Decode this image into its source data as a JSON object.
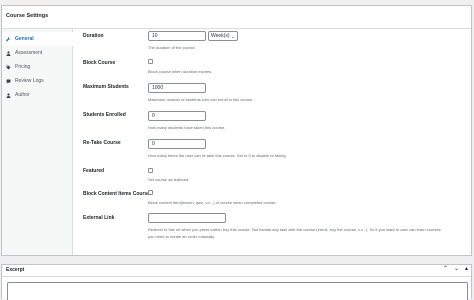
{
  "panel": {
    "title": "Course Settings"
  },
  "tabs": [
    {
      "label": "General",
      "icon": "wrench-icon",
      "active": true
    },
    {
      "label": "Assessment",
      "icon": "user-icon",
      "active": false
    },
    {
      "label": "Pricing",
      "icon": "tag-icon",
      "active": false
    },
    {
      "label": "Review Logs",
      "icon": "review-icon",
      "active": false
    },
    {
      "label": "Author",
      "icon": "user-icon",
      "active": false
    }
  ],
  "fields": {
    "duration": {
      "label": "Duration",
      "value": "10",
      "unit": "Week(s)",
      "desc": "The duration of the course."
    },
    "block_course": {
      "label": "Block Course",
      "desc": "Block course when duration expires."
    },
    "max_students": {
      "label": "Maximum Students",
      "value": "1000",
      "desc": "Maximum number of students who can enroll in this course."
    },
    "students_enrolled": {
      "label": "Students Enrolled",
      "value": "0",
      "desc": "How many students have taken this course."
    },
    "retake": {
      "label": "Re-Take Course",
      "value": "0",
      "desc": "How many times the user can re-take this course. Set to 0 to disable re-taking"
    },
    "featured": {
      "label": "Featured",
      "desc": "Set course as featured."
    },
    "block_items": {
      "label": "Block Content Items Course",
      "desc": "Block content item(lesson, quiz, v.v...) of course when completed course."
    },
    "external_link": {
      "label": "External Link",
      "value": "",
      "desc_line1": "Redirect to this url when you press button buy this course. Not handle any task with the course (enroll, buy the course, v.v...). So if you want to user can learn courses",
      "desc_line2": "you need to create an order manually."
    }
  },
  "excerpt": {
    "title": "Excerpt",
    "up": "⌃",
    "down": "⌄",
    "toggle": "▴"
  },
  "colors": {
    "accent": "#2271b1",
    "border": "#c3c4c7",
    "background": "#f0f0f1"
  }
}
